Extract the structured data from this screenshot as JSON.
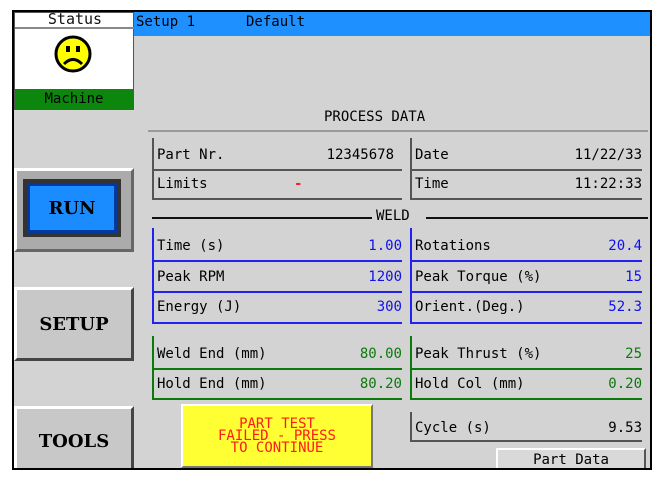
{
  "status": {
    "label": "Status",
    "machine": "Machine",
    "face_icon": "sad-face-icon",
    "face_color": "#ffff00"
  },
  "header": {
    "setup": "Setup 1",
    "profile": "Default",
    "color": "#1e90ff"
  },
  "nav": {
    "run": "RUN",
    "setup": "SETUP",
    "tools": "TOOLS"
  },
  "process": {
    "title": "PROCESS DATA",
    "part_label": "Part Nr.",
    "part_value": "12345678",
    "limits_label": "Limits",
    "limits_value": "-",
    "date_label": "Date",
    "date_value": "11/22/33",
    "time_label": "Time",
    "time_value": "11:22:33"
  },
  "weld": {
    "title": "WELD",
    "left": [
      {
        "label": "Time (s)",
        "value": "1.00"
      },
      {
        "label": "Peak RPM",
        "value": "1200"
      },
      {
        "label": "Energy (J)",
        "value": "300"
      }
    ],
    "right": [
      {
        "label": "Rotations",
        "value": "20.4"
      },
      {
        "label": "Peak Torque (%)",
        "value": "15"
      },
      {
        "label": "Orient.(Deg.)",
        "value": "52.3"
      }
    ],
    "left2": [
      {
        "label": "Weld End (mm)",
        "value": "80.00"
      },
      {
        "label": "Hold End (mm)",
        "value": "80.20"
      }
    ],
    "right2": [
      {
        "label": "Peak Thrust (%)",
        "value": "25"
      },
      {
        "label": "Hold Col (mm)",
        "value": "0.20"
      }
    ],
    "cycle_label": "Cycle (s)",
    "cycle_value": "9.53"
  },
  "alert": {
    "line1": "PART TEST",
    "line2": "FAILED - PRESS",
    "line3": "TO CONTINUE"
  },
  "part_data_button": "Part Data"
}
